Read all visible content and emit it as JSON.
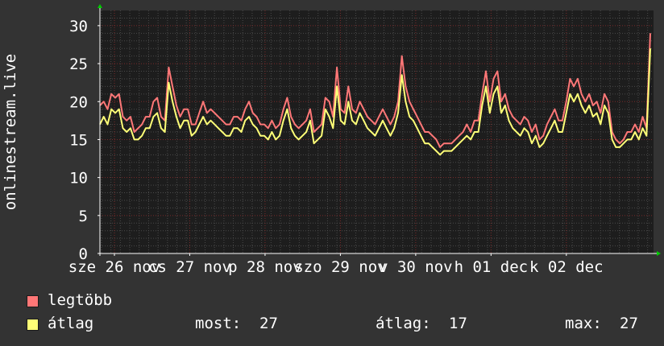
{
  "chart_data": {
    "type": "line",
    "ylabel": "onlinestream.live",
    "ylim": [
      0,
      32
    ],
    "y_ticks": [
      0,
      5,
      10,
      15,
      20,
      25,
      30
    ],
    "x_tick_labels": [
      "sze 26 nov",
      "cs 27 nov",
      "p 28 nov",
      "szo 29 nov",
      "v 30 nov",
      "h 01 dec",
      "k 02 dec"
    ],
    "grid": true,
    "legend": "bottom-left",
    "series": [
      {
        "name": "legtöbb",
        "color": "#ff7777",
        "values": [
          19.5,
          20,
          19,
          21,
          20.5,
          21,
          18,
          17.5,
          18,
          16,
          16.5,
          17,
          18,
          18,
          20,
          20.5,
          18,
          17.5,
          24.5,
          22,
          19.5,
          18,
          19,
          19,
          17,
          17,
          18.5,
          20,
          18.5,
          19,
          18.5,
          18,
          17.5,
          17,
          17,
          18,
          18,
          17.5,
          19,
          20,
          18.5,
          18,
          17,
          17,
          16.5,
          17.5,
          16.5,
          17,
          19,
          20.5,
          18,
          17,
          16.5,
          17,
          17.5,
          19,
          16,
          16.5,
          17,
          20.5,
          20,
          18,
          24.5,
          19,
          18.5,
          22,
          19,
          18.5,
          20,
          19,
          18,
          17.5,
          17,
          18,
          19,
          18,
          17,
          18,
          20,
          26,
          22,
          20,
          19,
          18,
          17,
          16,
          16,
          15.5,
          15,
          14,
          14.5,
          14.5,
          14.5,
          15,
          15.5,
          16,
          17,
          16,
          17.5,
          17.5,
          21,
          24,
          20,
          23,
          24,
          20,
          21,
          19,
          18,
          17.5,
          17,
          18,
          17.5,
          16,
          17,
          15,
          15.5,
          17,
          18,
          19,
          17.5,
          17.5,
          20,
          23,
          22,
          23,
          21,
          20,
          21,
          19.5,
          20,
          18.5,
          21,
          20,
          16,
          15,
          14.5,
          15,
          16,
          16,
          17,
          16,
          18,
          16.5,
          29
        ]
      },
      {
        "name": "átlag",
        "color": "#ffff77",
        "values": [
          17,
          18,
          17,
          19,
          18.5,
          19,
          16.5,
          16,
          16.5,
          15,
          15,
          15.5,
          16.5,
          16.5,
          18,
          18.5,
          16.5,
          16,
          22.5,
          20,
          18,
          16.5,
          17.5,
          17.5,
          15.5,
          16,
          17,
          18,
          17,
          17.5,
          17,
          16.5,
          16,
          15.5,
          15.5,
          16.5,
          16.5,
          16,
          17.5,
          18,
          17,
          16.5,
          15.5,
          15.5,
          15,
          16,
          15,
          15.5,
          17.5,
          19,
          16.5,
          15.5,
          15,
          15.5,
          16,
          17.5,
          14.5,
          15,
          15.5,
          19,
          18,
          16.5,
          22,
          17.5,
          17,
          20,
          17.5,
          17,
          18.5,
          17.5,
          16.5,
          16,
          15.5,
          16.5,
          17.5,
          16.5,
          15.5,
          16.5,
          18.5,
          23.5,
          20,
          18,
          17.5,
          16.5,
          15.5,
          14.5,
          14.5,
          14,
          13.5,
          13,
          13.5,
          13.5,
          13.5,
          14,
          14.5,
          15,
          15.5,
          15,
          16,
          16,
          19.5,
          22,
          18.5,
          21,
          22,
          18.5,
          19.5,
          17.5,
          16.5,
          16,
          15.5,
          16.5,
          16,
          14.5,
          15.5,
          14,
          14.5,
          15.5,
          16.5,
          17.5,
          16,
          16,
          18.5,
          21,
          20,
          21,
          19.5,
          18.5,
          19.5,
          18,
          18.5,
          17,
          19.5,
          18.5,
          15,
          14,
          14,
          14.5,
          15,
          15,
          16,
          15,
          16.5,
          15.5,
          27
        ]
      }
    ],
    "summary": {
      "most_label": "most:",
      "most_value": "27",
      "atlag_label": "átlag:",
      "atlag_value": "17",
      "max_label": "max:",
      "max_value": "27"
    }
  },
  "colors": {
    "background": "#333333",
    "plot_background": "#1d1d1d",
    "grid_minor": "#4a4a4a",
    "grid_major": "#7a2a2a",
    "axis": "#ffffff",
    "arrow": "#00cc00"
  }
}
